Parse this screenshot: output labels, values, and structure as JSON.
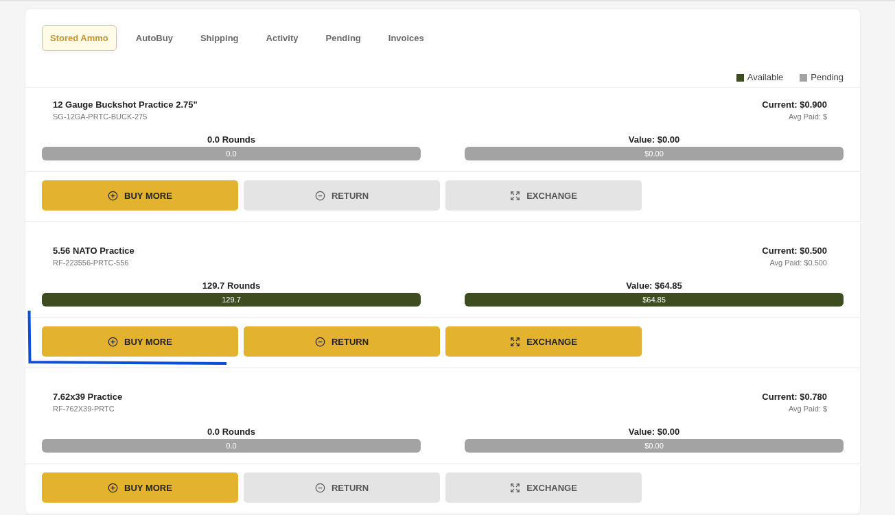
{
  "tabs": [
    {
      "label": "Stored Ammo",
      "selected": true
    },
    {
      "label": "AutoBuy",
      "selected": false
    },
    {
      "label": "Shipping",
      "selected": false
    },
    {
      "label": "Activity",
      "selected": false
    },
    {
      "label": "Pending",
      "selected": false
    },
    {
      "label": "Invoices",
      "selected": false
    }
  ],
  "legend": [
    {
      "label": "Available",
      "color": "#3d4d20"
    },
    {
      "label": "Pending",
      "color": "#a3a3a3"
    }
  ],
  "items": [
    {
      "name": "12 Gauge Buckshot Practice 2.75\"",
      "sku": "SG-12GA-PRTC-BUCK-275",
      "current": "Current: $0.900",
      "avg_paid": "Avg Paid: $",
      "rounds": {
        "label": "0.0 Rounds",
        "bar_text": "0.0",
        "level": 0
      },
      "value": {
        "label": "Value: $0.00",
        "bar_text": "$0.00",
        "level": 0
      },
      "buttons": [
        {
          "label": "BUY MORE",
          "kind": "buy",
          "disabled": false
        },
        {
          "label": "RETURN",
          "kind": "return",
          "disabled": true
        },
        {
          "label": "EXCHANGE",
          "kind": "exchange",
          "disabled": true
        }
      ],
      "marked": false
    },
    {
      "name": "5.56 NATO Practice",
      "sku": "RF-223556-PRTC-556",
      "current": "Current: $0.500",
      "avg_paid": "Avg Paid: $0.500",
      "rounds": {
        "label": "129.7 Rounds",
        "bar_text": "129.7",
        "level": 1
      },
      "value": {
        "label": "Value: $64.85",
        "bar_text": "$64.85",
        "level": 1
      },
      "buttons": [
        {
          "label": "BUY MORE",
          "kind": "buy",
          "disabled": false
        },
        {
          "label": "RETURN",
          "kind": "return",
          "disabled": false
        },
        {
          "label": "EXCHANGE",
          "kind": "exchange",
          "disabled": false
        }
      ],
      "marked": true
    },
    {
      "name": "7.62x39 Practice",
      "sku": "RF-762X39-PRTC",
      "current": "Current: $0.780",
      "avg_paid": "Avg Paid: $",
      "rounds": {
        "label": "0.0 Rounds",
        "bar_text": "0.0",
        "level": 0
      },
      "value": {
        "label": "Value: $0.00",
        "bar_text": "$0.00",
        "level": 0
      },
      "buttons": [
        {
          "label": "BUY MORE",
          "kind": "buy",
          "disabled": false
        },
        {
          "label": "RETURN",
          "kind": "return",
          "disabled": true
        },
        {
          "label": "EXCHANGE",
          "kind": "exchange",
          "disabled": true
        }
      ],
      "marked": false
    }
  ]
}
